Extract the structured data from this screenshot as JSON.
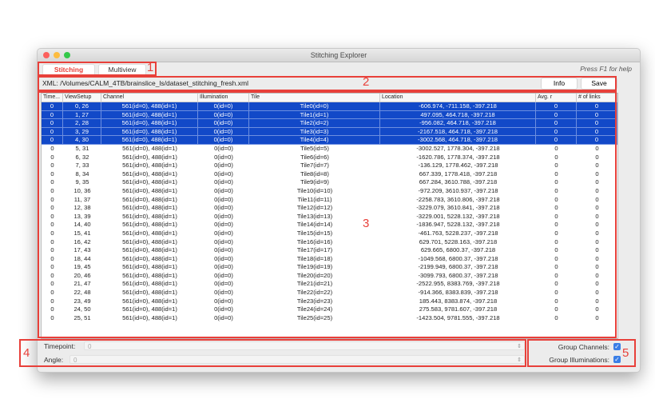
{
  "window": {
    "title": "Stitching Explorer",
    "help": "Press F1 for help"
  },
  "tabs": [
    {
      "label": "Stitching",
      "active": true
    },
    {
      "label": "Multiview",
      "active": false
    }
  ],
  "xml": {
    "label": "XML:",
    "path": "/Volumes/CALM_4TB/brainslice_ls/dataset_stitching_fresh.xml"
  },
  "buttons": {
    "info": "Info",
    "save": "Save"
  },
  "table": {
    "columns": [
      "Time...",
      "ViewSetup",
      "Channel",
      "Illumination",
      "Tile",
      "Location",
      "Avg. r",
      "# of links"
    ],
    "rows": [
      [
        "0",
        "0, 26",
        "561(id=0), 488(id=1)",
        "0(id=0)",
        "Tile0(id=0)",
        "-606.974, -711.158, -397.218",
        "0",
        "0",
        true
      ],
      [
        "0",
        "1, 27",
        "561(id=0), 488(id=1)",
        "0(id=0)",
        "Tile1(id=1)",
        "497.095, 464.718, -397.218",
        "0",
        "0",
        true
      ],
      [
        "0",
        "2, 28",
        "561(id=0), 488(id=1)",
        "0(id=0)",
        "Tile2(id=2)",
        "-956.082, 464.718, -397.218",
        "0",
        "0",
        true
      ],
      [
        "0",
        "3, 29",
        "561(id=0), 488(id=1)",
        "0(id=0)",
        "Tile3(id=3)",
        "-2167.518, 464.718, -397.218",
        "0",
        "0",
        true
      ],
      [
        "0",
        "4, 30",
        "561(id=0), 488(id=1)",
        "0(id=0)",
        "Tile4(id=4)",
        "-3002.568, 464.718, -397.218",
        "0",
        "0",
        true
      ],
      [
        "0",
        "5, 31",
        "561(id=0), 488(id=1)",
        "0(id=0)",
        "Tile5(id=5)",
        "-3002.527, 1778.304, -397.218",
        "0",
        "0",
        false
      ],
      [
        "0",
        "6, 32",
        "561(id=0), 488(id=1)",
        "0(id=0)",
        "Tile6(id=6)",
        "-1620.786, 1778.374, -397.218",
        "0",
        "0",
        false
      ],
      [
        "0",
        "7, 33",
        "561(id=0), 488(id=1)",
        "0(id=0)",
        "Tile7(id=7)",
        "-136.129, 1778.462, -397.218",
        "0",
        "0",
        false
      ],
      [
        "0",
        "8, 34",
        "561(id=0), 488(id=1)",
        "0(id=0)",
        "Tile8(id=8)",
        "667.339, 1778.418, -397.218",
        "0",
        "0",
        false
      ],
      [
        "0",
        "9, 35",
        "561(id=0), 488(id=1)",
        "0(id=0)",
        "Tile9(id=9)",
        "667.284, 3610.788, -397.218",
        "0",
        "0",
        false
      ],
      [
        "0",
        "10, 36",
        "561(id=0), 488(id=1)",
        "0(id=0)",
        "Tile10(id=10)",
        "-972.209, 3610.937, -397.218",
        "0",
        "0",
        false
      ],
      [
        "0",
        "11, 37",
        "561(id=0), 488(id=1)",
        "0(id=0)",
        "Tile11(id=11)",
        "-2258.783, 3610.806, -397.218",
        "0",
        "0",
        false
      ],
      [
        "0",
        "12, 38",
        "561(id=0), 488(id=1)",
        "0(id=0)",
        "Tile12(id=12)",
        "-3229.079, 3610.841, -397.218",
        "0",
        "0",
        false
      ],
      [
        "0",
        "13, 39",
        "561(id=0), 488(id=1)",
        "0(id=0)",
        "Tile13(id=13)",
        "-3229.001, 5228.132, -397.218",
        "0",
        "0",
        false
      ],
      [
        "0",
        "14, 40",
        "561(id=0), 488(id=1)",
        "0(id=0)",
        "Tile14(id=14)",
        "-1836.947, 5228.132, -397.218",
        "0",
        "0",
        false
      ],
      [
        "0",
        "15, 41",
        "561(id=0), 488(id=1)",
        "0(id=0)",
        "Tile15(id=15)",
        "-461.763, 5228.237, -397.218",
        "0",
        "0",
        false
      ],
      [
        "0",
        "16, 42",
        "561(id=0), 488(id=1)",
        "0(id=0)",
        "Tile16(id=16)",
        "629.701, 5228.163, -397.218",
        "0",
        "0",
        false
      ],
      [
        "0",
        "17, 43",
        "561(id=0), 488(id=1)",
        "0(id=0)",
        "Tile17(id=17)",
        "629.665, 6800.37, -397.218",
        "0",
        "0",
        false
      ],
      [
        "0",
        "18, 44",
        "561(id=0), 488(id=1)",
        "0(id=0)",
        "Tile18(id=18)",
        "-1049.568, 6800.37, -397.218",
        "0",
        "0",
        false
      ],
      [
        "0",
        "19, 45",
        "561(id=0), 488(id=1)",
        "0(id=0)",
        "Tile19(id=19)",
        "-2199.949, 6800.37, -397.218",
        "0",
        "0",
        false
      ],
      [
        "0",
        "20, 46",
        "561(id=0), 488(id=1)",
        "0(id=0)",
        "Tile20(id=20)",
        "-3099.793, 6800.37, -397.218",
        "0",
        "0",
        false
      ],
      [
        "0",
        "21, 47",
        "561(id=0), 488(id=1)",
        "0(id=0)",
        "Tile21(id=21)",
        "-2522.955, 8383.769, -397.218",
        "0",
        "0",
        false
      ],
      [
        "0",
        "22, 48",
        "561(id=0), 488(id=1)",
        "0(id=0)",
        "Tile22(id=22)",
        "-914.366, 8383.839, -397.218",
        "0",
        "0",
        false
      ],
      [
        "0",
        "23, 49",
        "561(id=0), 488(id=1)",
        "0(id=0)",
        "Tile23(id=23)",
        "185.443, 8383.874, -397.218",
        "0",
        "0",
        false
      ],
      [
        "0",
        "24, 50",
        "561(id=0), 488(id=1)",
        "0(id=0)",
        "Tile24(id=24)",
        "275.583, 9781.607, -397.218",
        "0",
        "0",
        false
      ],
      [
        "0",
        "25, 51",
        "561(id=0), 488(id=1)",
        "0(id=0)",
        "Tile25(id=25)",
        "-1423.504, 9781.555, -397.218",
        "0",
        "0",
        false
      ]
    ]
  },
  "bottom": {
    "timepoint_label": "Timepoint:",
    "timepoint_value": "0",
    "angle_label": "Angle:",
    "angle_value": "0",
    "group_channels_label": "Group Channels:",
    "group_channels": true,
    "group_illuminations_label": "Group Illuminations:",
    "group_illuminations": true
  },
  "annotations": [
    "1",
    "2",
    "3",
    "4",
    "5"
  ],
  "colors": {
    "selection": "#1249c8",
    "annotation": "#e8403a",
    "active_tab": "#e8403a"
  }
}
